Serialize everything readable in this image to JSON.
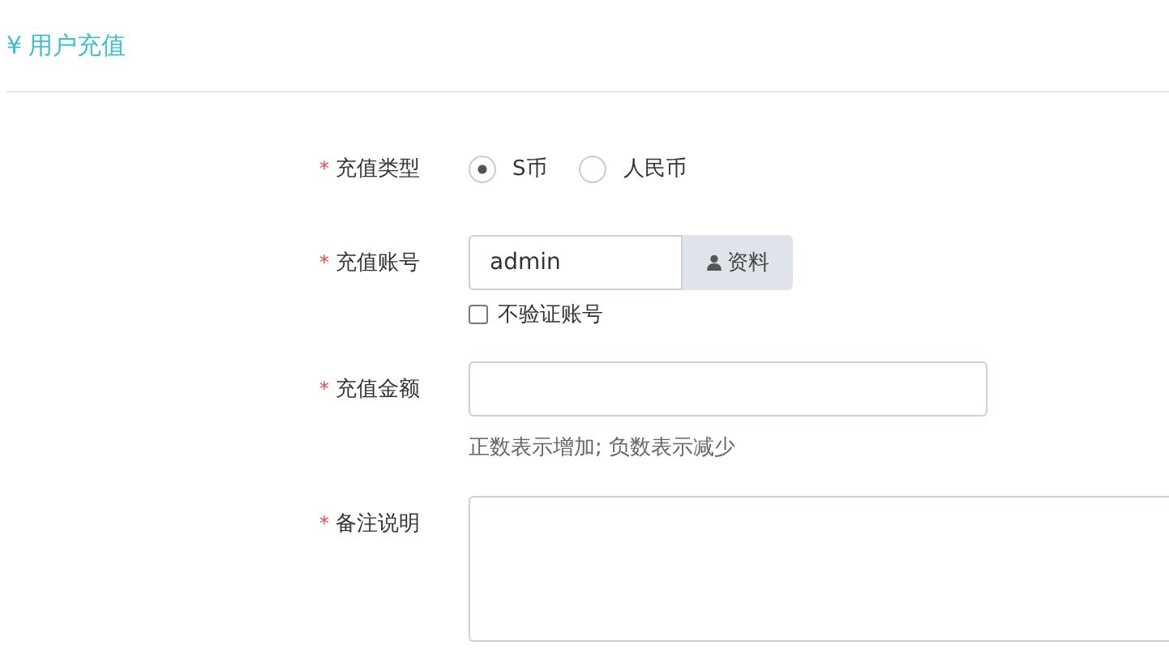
{
  "header": {
    "icon": "¥",
    "title": "用户充值"
  },
  "fields": [
    {
      "kind": "radio",
      "required_mark": "*",
      "label": "充值类型",
      "options": [
        {
          "label": "S币",
          "selected": true
        },
        {
          "label": "人民币",
          "selected": false
        }
      ]
    },
    {
      "kind": "input-addon",
      "required_mark": "*",
      "label": "充值账号",
      "value": "admin",
      "addon": "资料",
      "checkbox": {
        "label": "不验证账号",
        "checked": false
      }
    },
    {
      "kind": "input",
      "required_mark": "*",
      "label": "充值金额",
      "hint": "正数表示增加; 负数表示减少"
    },
    {
      "kind": "textarea",
      "required_mark": "*",
      "label": "备注说明"
    }
  ]
}
